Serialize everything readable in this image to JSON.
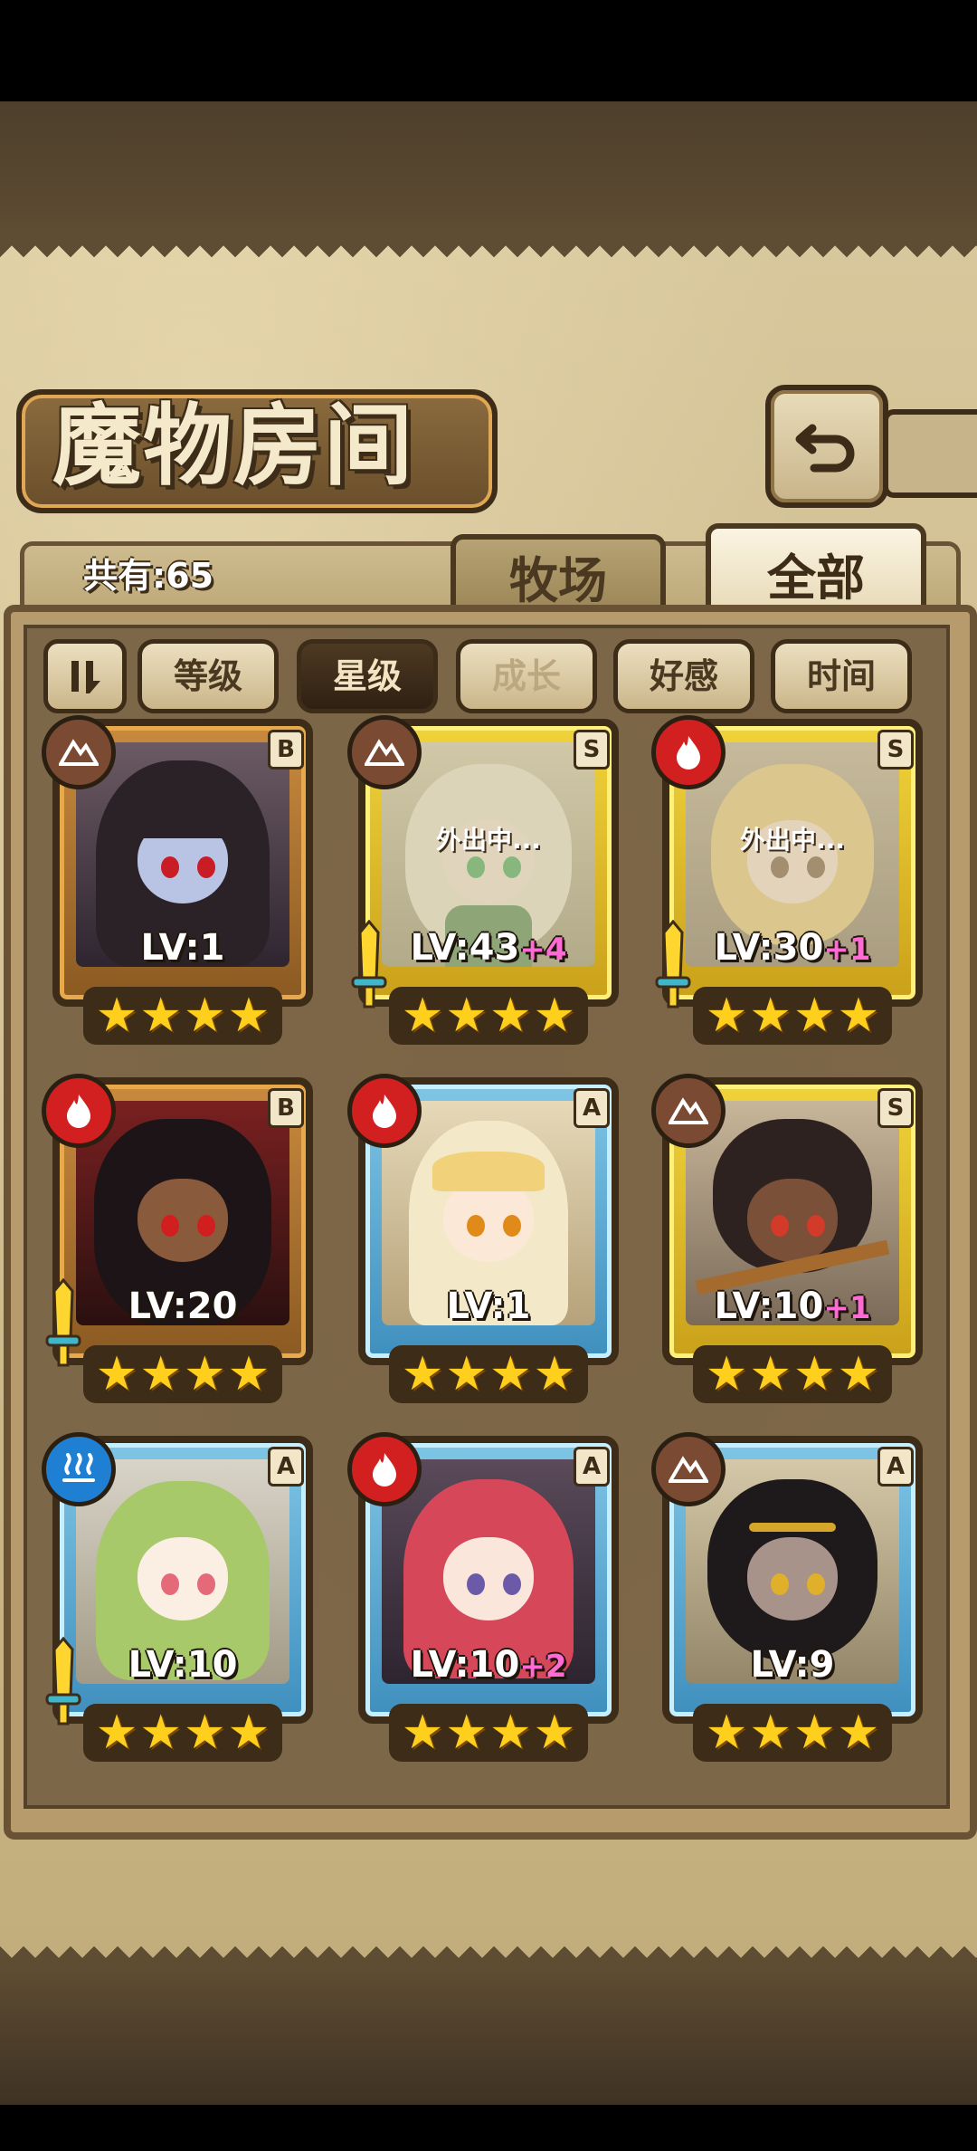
{
  "header": {
    "title": "魔物房间",
    "count_label": "共有:65"
  },
  "tabs": [
    {
      "label": "牧场"
    },
    {
      "label": "全部"
    }
  ],
  "sort_buttons": [
    {
      "label": "等级"
    },
    {
      "label": "星级"
    },
    {
      "label": "成长"
    },
    {
      "label": "好感"
    },
    {
      "label": "时间"
    }
  ],
  "active_sort": "星级",
  "away_label": "外出中...",
  "monsters": [
    {
      "level": "LV:1",
      "bonus": "",
      "rarity": "B",
      "element": "earth-icon",
      "stars": 4,
      "away": false,
      "weapon": false
    },
    {
      "level": "LV:43",
      "bonus": "+4",
      "rarity": "S",
      "element": "earth-icon",
      "stars": 4,
      "away": true,
      "weapon": true
    },
    {
      "level": "LV:30",
      "bonus": "+1",
      "rarity": "S",
      "element": "fire-icon",
      "stars": 4,
      "away": true,
      "weapon": true
    },
    {
      "level": "LV:20",
      "bonus": "",
      "rarity": "B",
      "element": "fire-icon",
      "stars": 4,
      "away": false,
      "weapon": true
    },
    {
      "level": "LV:1",
      "bonus": "",
      "rarity": "A",
      "element": "fire-icon",
      "stars": 4,
      "away": false,
      "weapon": false
    },
    {
      "level": "LV:10",
      "bonus": "+1",
      "rarity": "S",
      "element": "earth-icon",
      "stars": 4,
      "away": false,
      "weapon": false
    },
    {
      "level": "LV:10",
      "bonus": "",
      "rarity": "A",
      "element": "water-icon",
      "stars": 4,
      "away": false,
      "weapon": true
    },
    {
      "level": "LV:10",
      "bonus": "+2",
      "rarity": "A",
      "element": "fire-icon",
      "stars": 4,
      "away": false,
      "weapon": false
    },
    {
      "level": "LV:9",
      "bonus": "",
      "rarity": "A",
      "element": "earth-icon",
      "stars": 4,
      "away": false,
      "weapon": false
    }
  ]
}
